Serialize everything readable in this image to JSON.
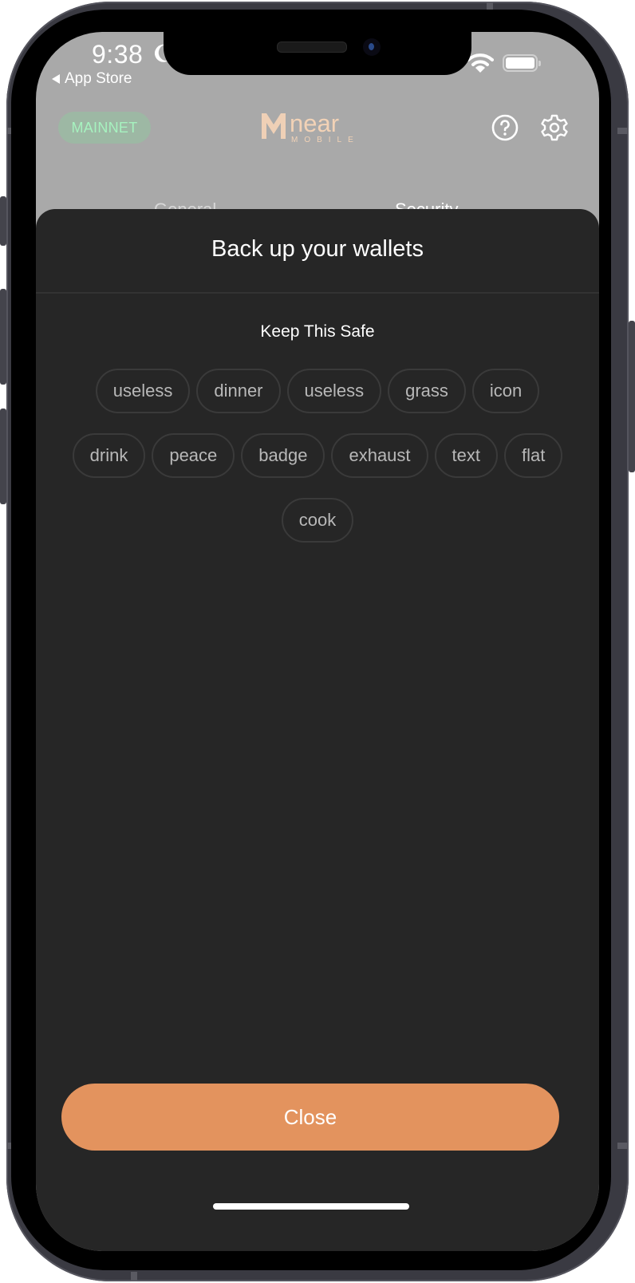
{
  "status_bar": {
    "time": "9:38",
    "back_app_label": "App Store"
  },
  "header": {
    "network_badge": "MAINNET",
    "logo_word": "near",
    "logo_sub": "MOBILE",
    "help_icon": "question-circle-icon",
    "settings_icon": "gear-icon"
  },
  "tabs": [
    {
      "label": "General"
    },
    {
      "label": "Security"
    }
  ],
  "sheet": {
    "title": "Back up your wallets",
    "subtitle": "Keep This Safe",
    "words": [
      "useless",
      "dinner",
      "useless",
      "grass",
      "icon",
      "drink",
      "peace",
      "badge",
      "exhaust",
      "text",
      "flat",
      "cook"
    ],
    "close_label": "Close"
  },
  "colors": {
    "accent": "#e3935e",
    "sheet_bg": "#262626",
    "dimmed_bg": "#a9a9a9",
    "mainnet_text": "#a6f2bf",
    "logo": "#f2d2b6"
  }
}
